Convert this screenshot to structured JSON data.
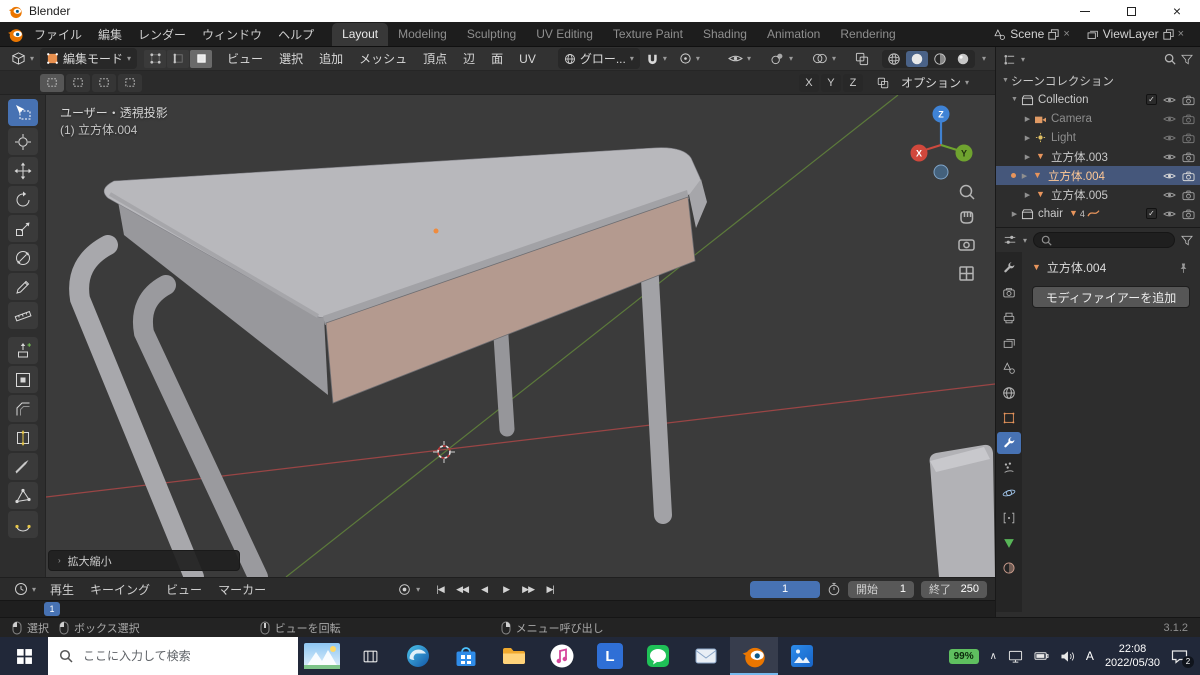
{
  "window": {
    "title": "Blender"
  },
  "glyphs": {
    "close": "×",
    "chevron_down": "▾",
    "tree_open": "▼",
    "tree_closed": "▶",
    "check": "✓",
    "mesh_triangle": "▼",
    "panel_arrow": "›",
    "tray_chevron": "∧"
  },
  "topbar": {
    "menus": [
      "ファイル",
      "編集",
      "レンダー",
      "ウィンドウ",
      "ヘルプ"
    ],
    "workspaces": [
      "Layout",
      "Modeling",
      "Sculpting",
      "UV Editing",
      "Texture Paint",
      "Shading",
      "Animation",
      "Rendering"
    ],
    "active_workspace": "Layout",
    "scene": "Scene",
    "view_layer": "ViewLayer"
  },
  "viewport_header": {
    "mode": "編集モード",
    "menus": [
      "ビュー",
      "選択",
      "追加",
      "メッシュ",
      "頂点",
      "辺",
      "面",
      "UV"
    ],
    "orientation": "グロー...",
    "options": "オプション",
    "mirror_axes": [
      "X",
      "Y",
      "Z"
    ]
  },
  "viewport": {
    "view_label": "ユーザー・透視投影",
    "selection_label": "(1) 立方体.004",
    "operator_panel": "拡大縮小",
    "axes": {
      "x": "X",
      "y": "Y",
      "z": "Z"
    }
  },
  "timeline": {
    "menus": [
      "再生",
      "キーイング",
      "ビュー",
      "マーカー"
    ],
    "playback": [
      "|◀",
      "◀◀",
      "◀",
      "▶",
      "▶▶",
      "▶|"
    ],
    "current_frame": "1",
    "start_label": "開始",
    "start_value": "1",
    "end_label": "終了",
    "end_value": "250"
  },
  "statusbar": {
    "hints": [
      "選択",
      "ボックス選択",
      "ビューを回転",
      "メニュー呼び出し"
    ],
    "version": "3.1.2"
  },
  "outliner": {
    "root": "シーンコレクション",
    "rows": [
      {
        "label": "Collection"
      },
      {
        "label": "Camera"
      },
      {
        "label": "Light"
      },
      {
        "label": "立方体.003"
      },
      {
        "label": "立方体.004"
      },
      {
        "label": "立方体.005"
      },
      {
        "label": "chair",
        "mesh_count": "4"
      }
    ]
  },
  "properties": {
    "active_object": "立方体.004",
    "add_modifier": "モディファイアーを追加"
  },
  "taskbar": {
    "search_placeholder": "ここに入力して検索",
    "battery": "99%",
    "ime": "A",
    "time": "22:08",
    "date": "2022/05/30",
    "notifications": "2",
    "l_app_letter": "L"
  },
  "colors": {
    "accent": "#4772b3",
    "selected_row": "#45577b",
    "active_object_text": "#ffc896",
    "desk_top": "#b8b8bc",
    "selected_face": "#b49a8f",
    "axis_x": "#9a4545",
    "axis_y": "#5c7a3b",
    "gizmo_x": "#d1483c",
    "gizmo_y": "#6fa32f",
    "gizmo_z": "#3f83d6",
    "taskbar_battery_green": "#5fbf5f"
  }
}
